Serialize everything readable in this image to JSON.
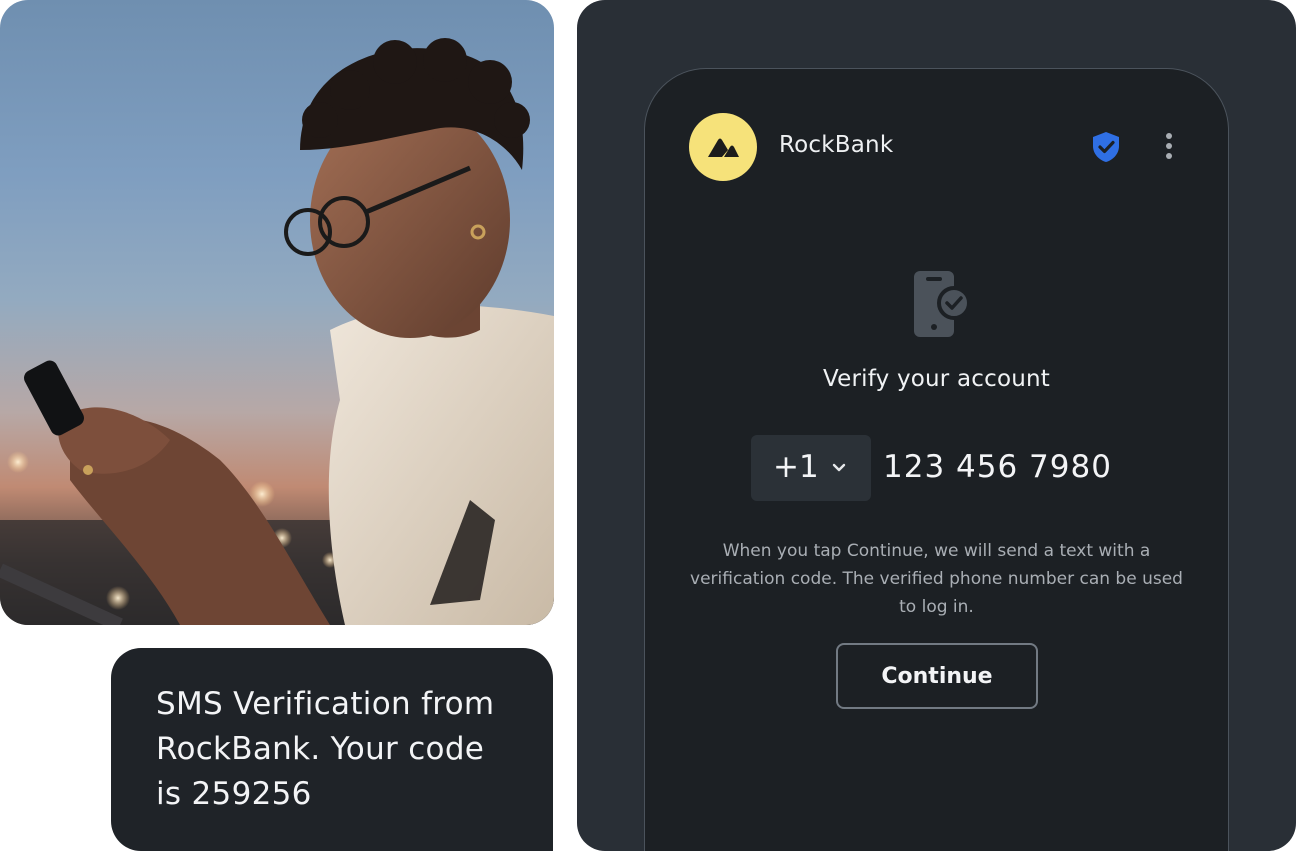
{
  "sms": {
    "message": "SMS Verification from RockBank. Your code is 259256"
  },
  "app": {
    "name": "RockBank",
    "logo_icon": "rockbank-logo-icon",
    "header_icons": [
      "shield-check-icon",
      "more-vertical-icon"
    ],
    "accent_color": "#2f6fe4",
    "logo_color": "#f6e27a"
  },
  "verify": {
    "icon": "phone-check-icon",
    "title": "Verify your account",
    "country_code": "+1",
    "phone_number": "123 456 7980",
    "info": "When you tap Continue, we will send a text with a verification code. The verified phone number can be used to log in.",
    "continue_label": "Continue"
  }
}
